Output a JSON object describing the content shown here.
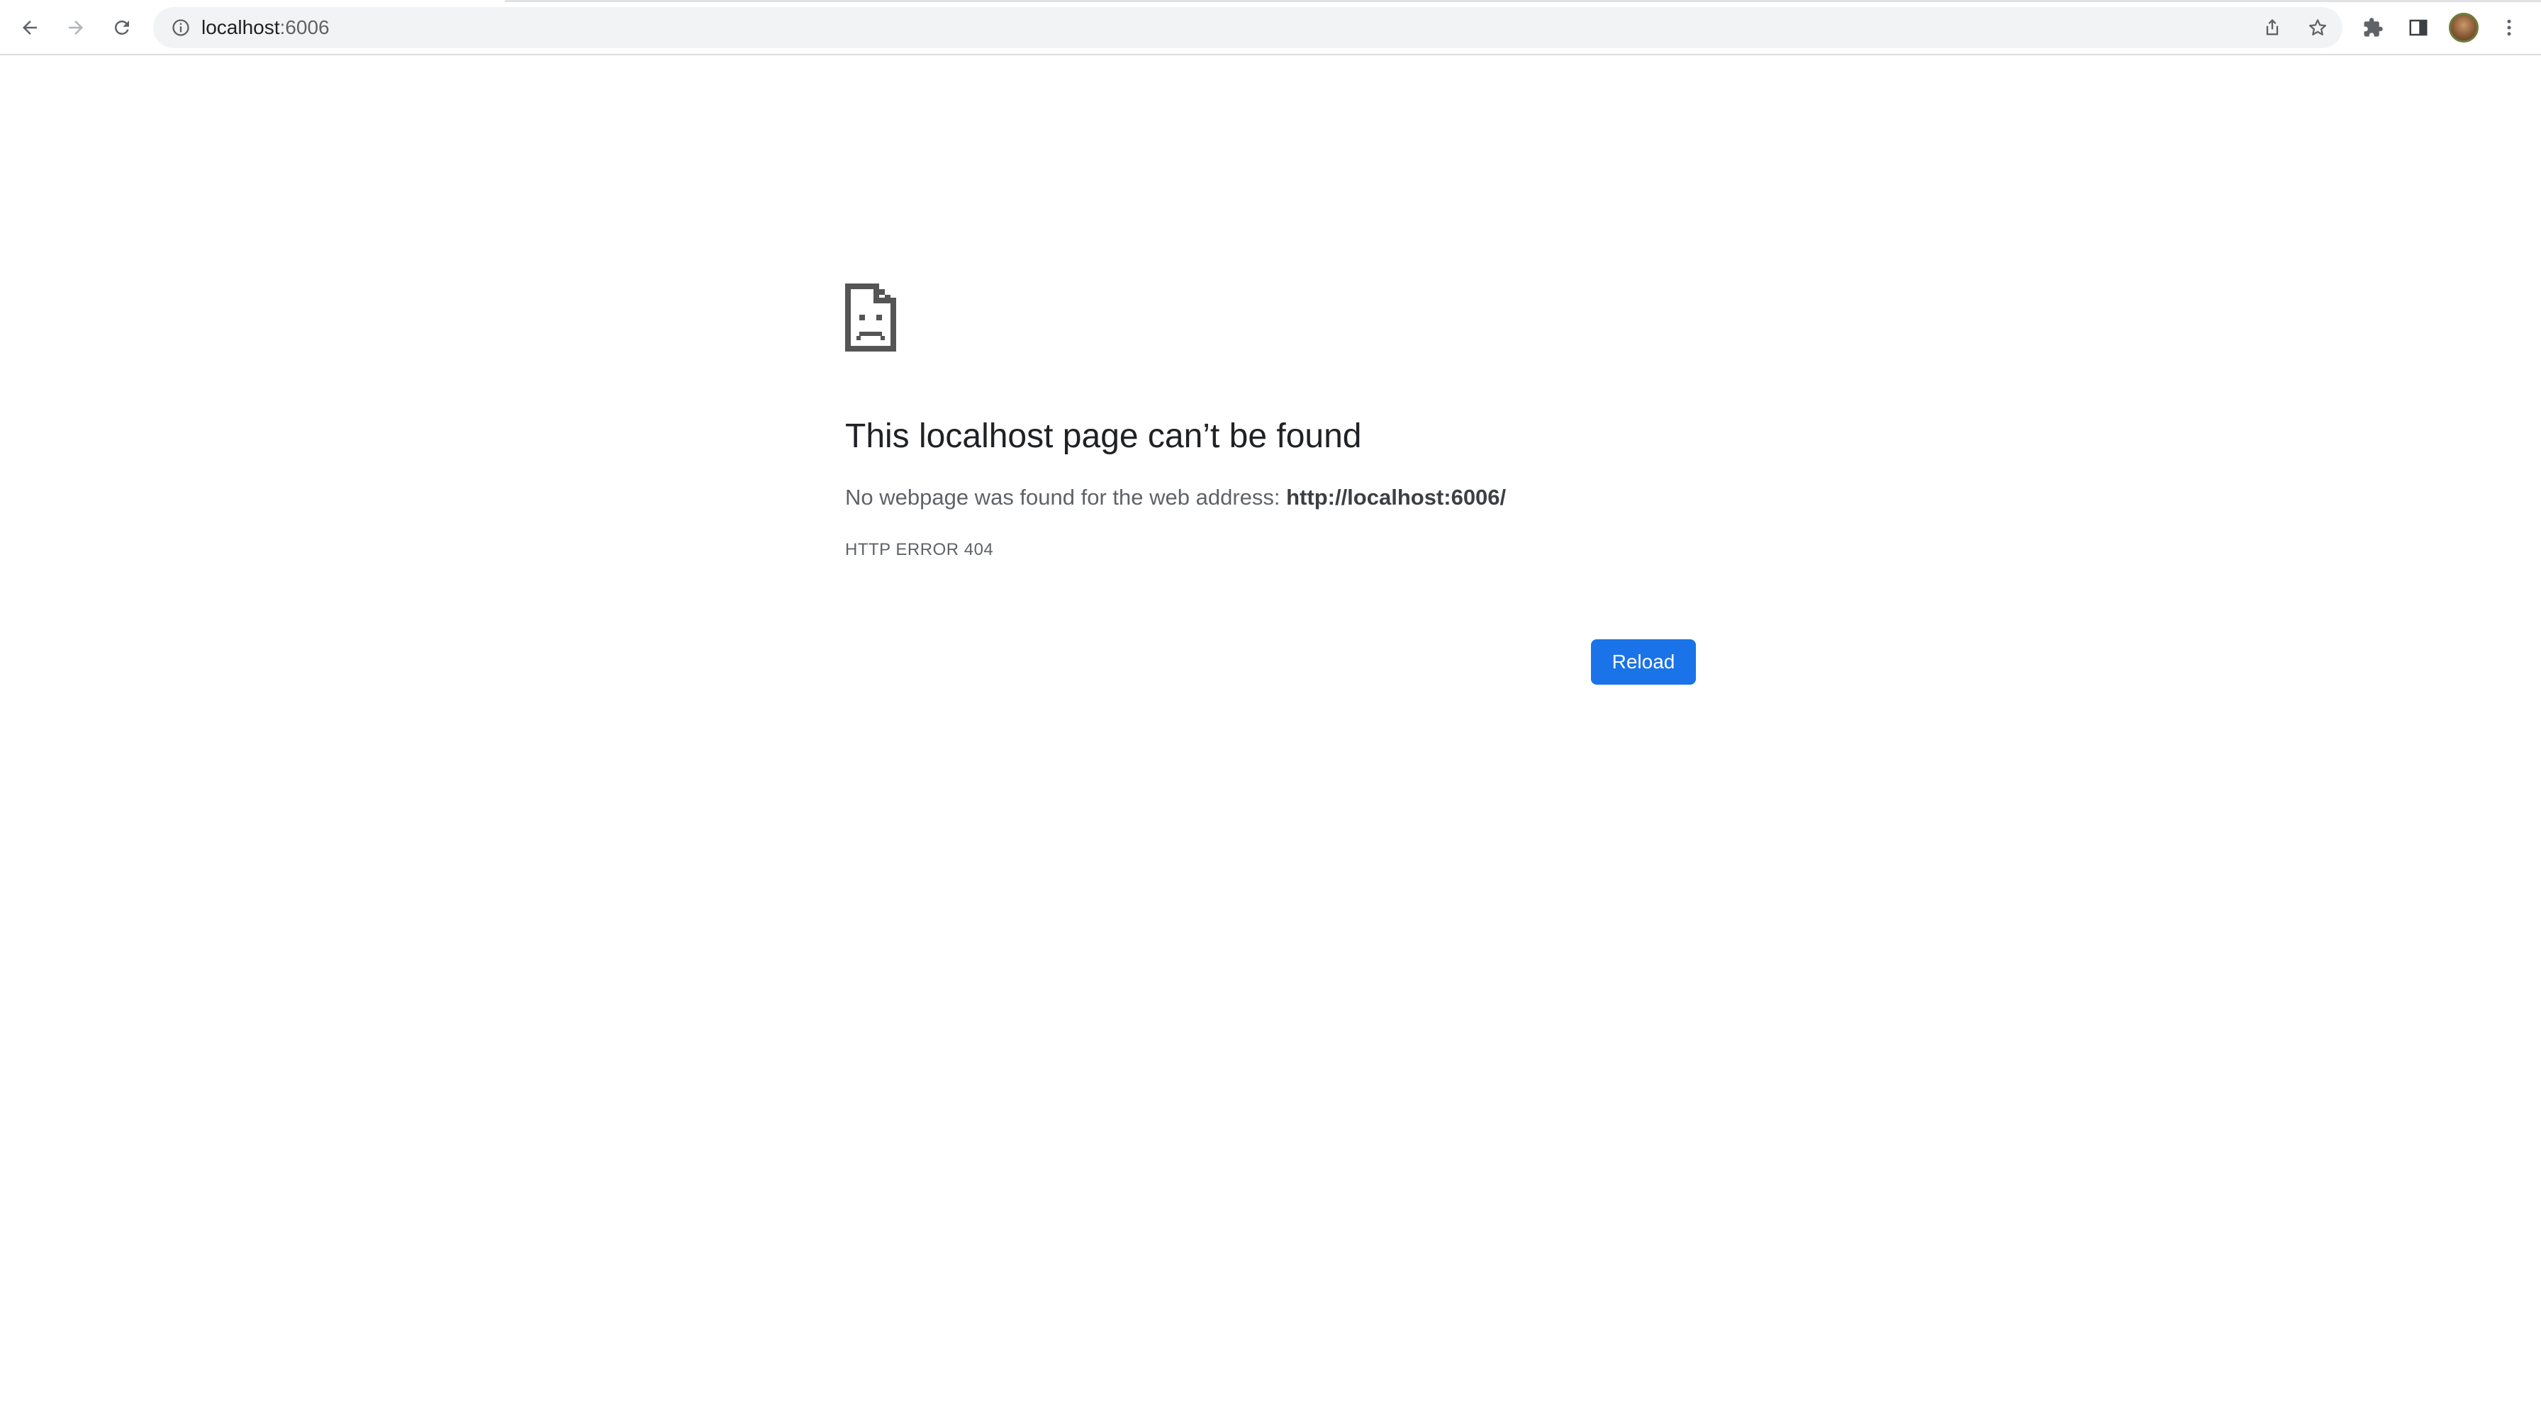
{
  "browser": {
    "url_host": "localhost",
    "url_port": ":6006",
    "icons": {
      "back": "back-arrow-icon",
      "forward": "forward-arrow-icon",
      "reload": "reload-icon",
      "site_info": "info-icon",
      "share": "share-icon",
      "bookmark": "star-icon",
      "extensions": "puzzle-icon",
      "side_panel": "side-panel-icon",
      "menu": "kebab-menu-icon"
    }
  },
  "error_page": {
    "icon": "sad-document-icon",
    "title": "This localhost page can’t be found",
    "description_prefix": "No webpage was found for the web address: ",
    "description_url": "http://localhost:6006/",
    "error_code": "HTTP ERROR 404",
    "reload_label": "Reload"
  },
  "colors": {
    "accent": "#1a73e8",
    "text_primary": "#202124",
    "text_secondary": "#5f6368",
    "omnibox_bg": "#f1f3f4"
  }
}
